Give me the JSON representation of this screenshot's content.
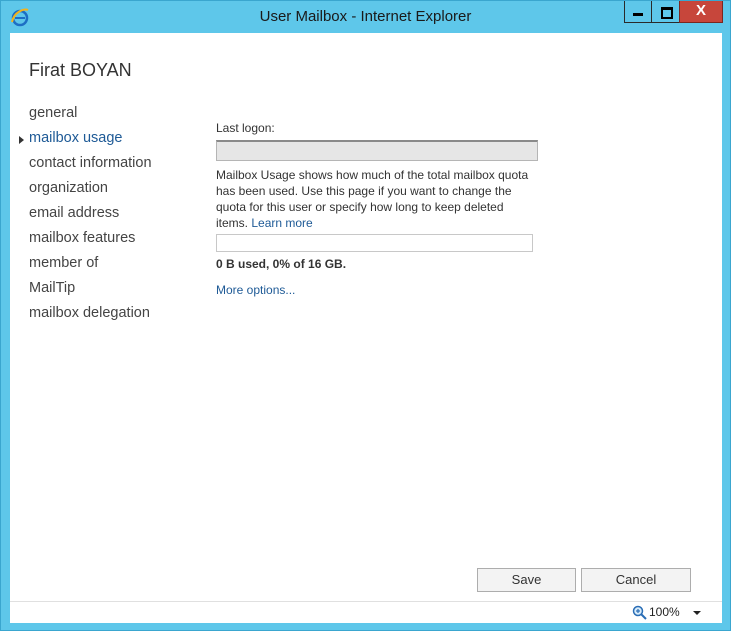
{
  "window": {
    "title": "User Mailbox - Internet Explorer",
    "icon": "ie-icon",
    "close_label": "X",
    "accent": "#5ec7ea"
  },
  "page": {
    "user_name": "Firat BOYAN",
    "nav": [
      {
        "label": "general",
        "active": false
      },
      {
        "label": "mailbox usage",
        "active": true
      },
      {
        "label": "contact information",
        "active": false
      },
      {
        "label": "organization",
        "active": false
      },
      {
        "label": "email address",
        "active": false
      },
      {
        "label": "mailbox features",
        "active": false
      },
      {
        "label": "member of",
        "active": false
      },
      {
        "label": "MailTip",
        "active": false
      },
      {
        "label": "mailbox delegation",
        "active": false
      }
    ],
    "last_logon_label": "Last logon:",
    "last_logon_value": "",
    "description": "Mailbox Usage shows how much of the total mailbox quota has been used. Use this page if you want to change the quota for this user or specify how long to keep deleted items.",
    "learn_more": "Learn more",
    "usage_fraction": 0,
    "usage_text": "0 B used, 0% of 16 GB.",
    "more_options": "More options...",
    "save_label": "Save",
    "cancel_label": "Cancel"
  },
  "statusbar": {
    "zoom": "100%"
  }
}
